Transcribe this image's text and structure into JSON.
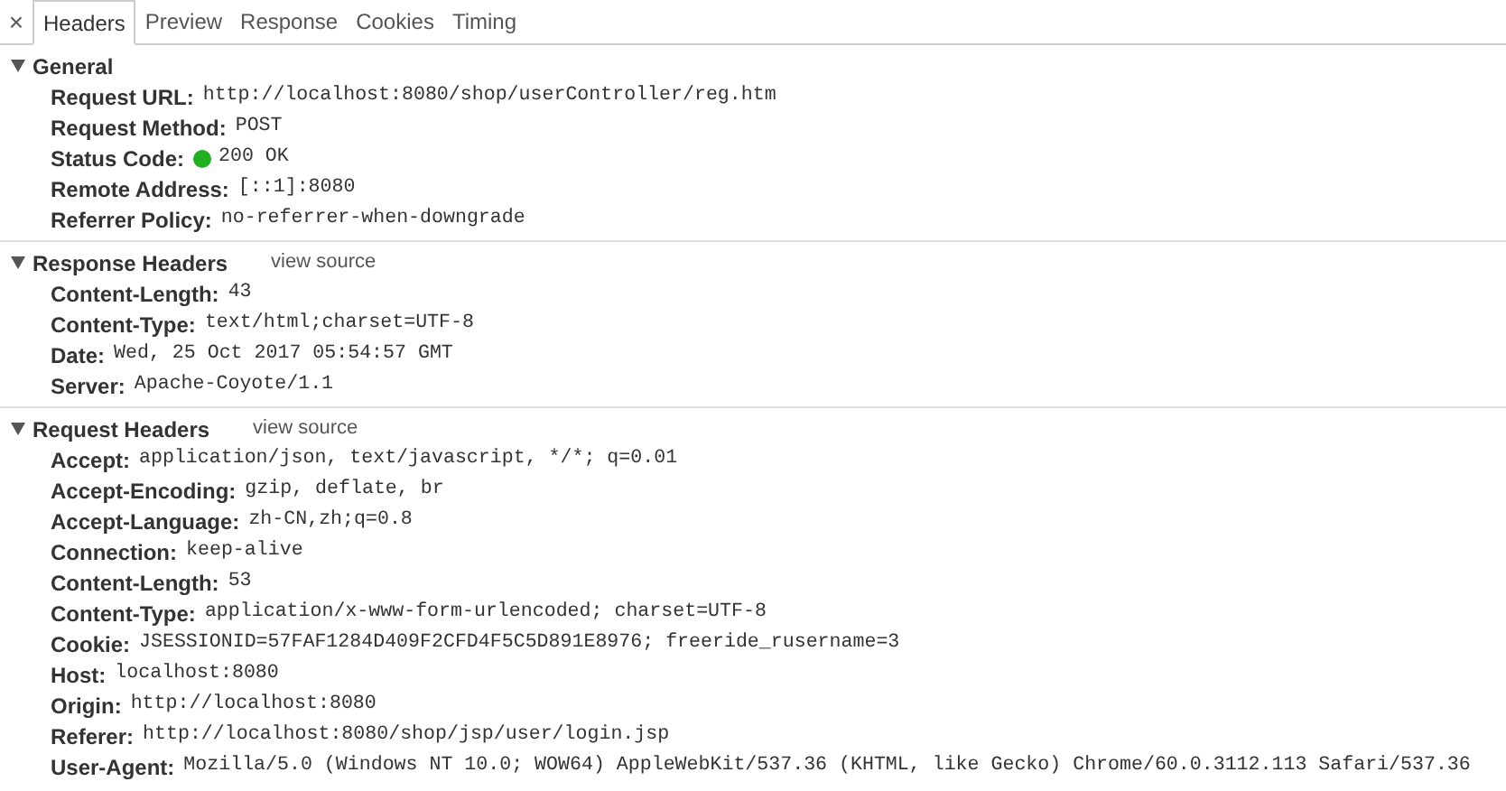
{
  "close_button": "×",
  "tabs": [
    {
      "label": "Headers",
      "selected": true
    },
    {
      "label": "Preview",
      "selected": false
    },
    {
      "label": "Response",
      "selected": false
    },
    {
      "label": "Cookies",
      "selected": false
    },
    {
      "label": "Timing",
      "selected": false
    }
  ],
  "sections": [
    {
      "title": "General",
      "expanded": true,
      "rows": [
        {
          "kind": "text",
          "name": "Request URL:",
          "value": "http://localhost:8080/shop/userController/reg.htm"
        },
        {
          "kind": "text",
          "name": "Request Method:",
          "value": "POST"
        },
        {
          "kind": "status",
          "name": "Status Code:",
          "value": "200 OK",
          "color": "#22b022"
        },
        {
          "kind": "text",
          "name": "Remote Address:",
          "value": "[::1]:8080"
        },
        {
          "kind": "text",
          "name": "Referrer Policy:",
          "value": "no-referrer-when-downgrade"
        }
      ]
    },
    {
      "title": "Response Headers",
      "expanded": true,
      "link": "view source",
      "rows": [
        {
          "kind": "text",
          "name": "Content-Length:",
          "value": "43"
        },
        {
          "kind": "text",
          "name": "Content-Type:",
          "value": "text/html;charset=UTF-8"
        },
        {
          "kind": "text",
          "name": "Date:",
          "value": "Wed, 25 Oct 2017 05:54:57 GMT"
        },
        {
          "kind": "text",
          "name": "Server:",
          "value": "Apache-Coyote/1.1"
        }
      ]
    },
    {
      "title": "Request Headers",
      "expanded": true,
      "link": "view source",
      "rows": [
        {
          "kind": "text",
          "name": "Accept:",
          "value": "application/json, text/javascript, */*; q=0.01"
        },
        {
          "kind": "text",
          "name": "Accept-Encoding:",
          "value": "gzip, deflate, br"
        },
        {
          "kind": "text",
          "name": "Accept-Language:",
          "value": "zh-CN,zh;q=0.8"
        },
        {
          "kind": "text",
          "name": "Connection:",
          "value": "keep-alive"
        },
        {
          "kind": "text",
          "name": "Content-Length:",
          "value": "53"
        },
        {
          "kind": "text",
          "name": "Content-Type:",
          "value": "application/x-www-form-urlencoded; charset=UTF-8"
        },
        {
          "kind": "text",
          "name": "Cookie:",
          "value": "JSESSIONID=57FAF1284D409F2CFD4F5C5D891E8976; freeride_rusername=3"
        },
        {
          "kind": "text",
          "name": "Host:",
          "value": "localhost:8080"
        },
        {
          "kind": "text",
          "name": "Origin:",
          "value": "http://localhost:8080"
        },
        {
          "kind": "text",
          "name": "Referer:",
          "value": "http://localhost:8080/shop/jsp/user/login.jsp"
        },
        {
          "kind": "text",
          "name": "User-Agent:",
          "value": "Mozilla/5.0 (Windows NT 10.0; WOW64) AppleWebKit/537.36 (KHTML, like Gecko) Chrome/60.0.3112.113 Safari/537.36"
        }
      ]
    }
  ]
}
